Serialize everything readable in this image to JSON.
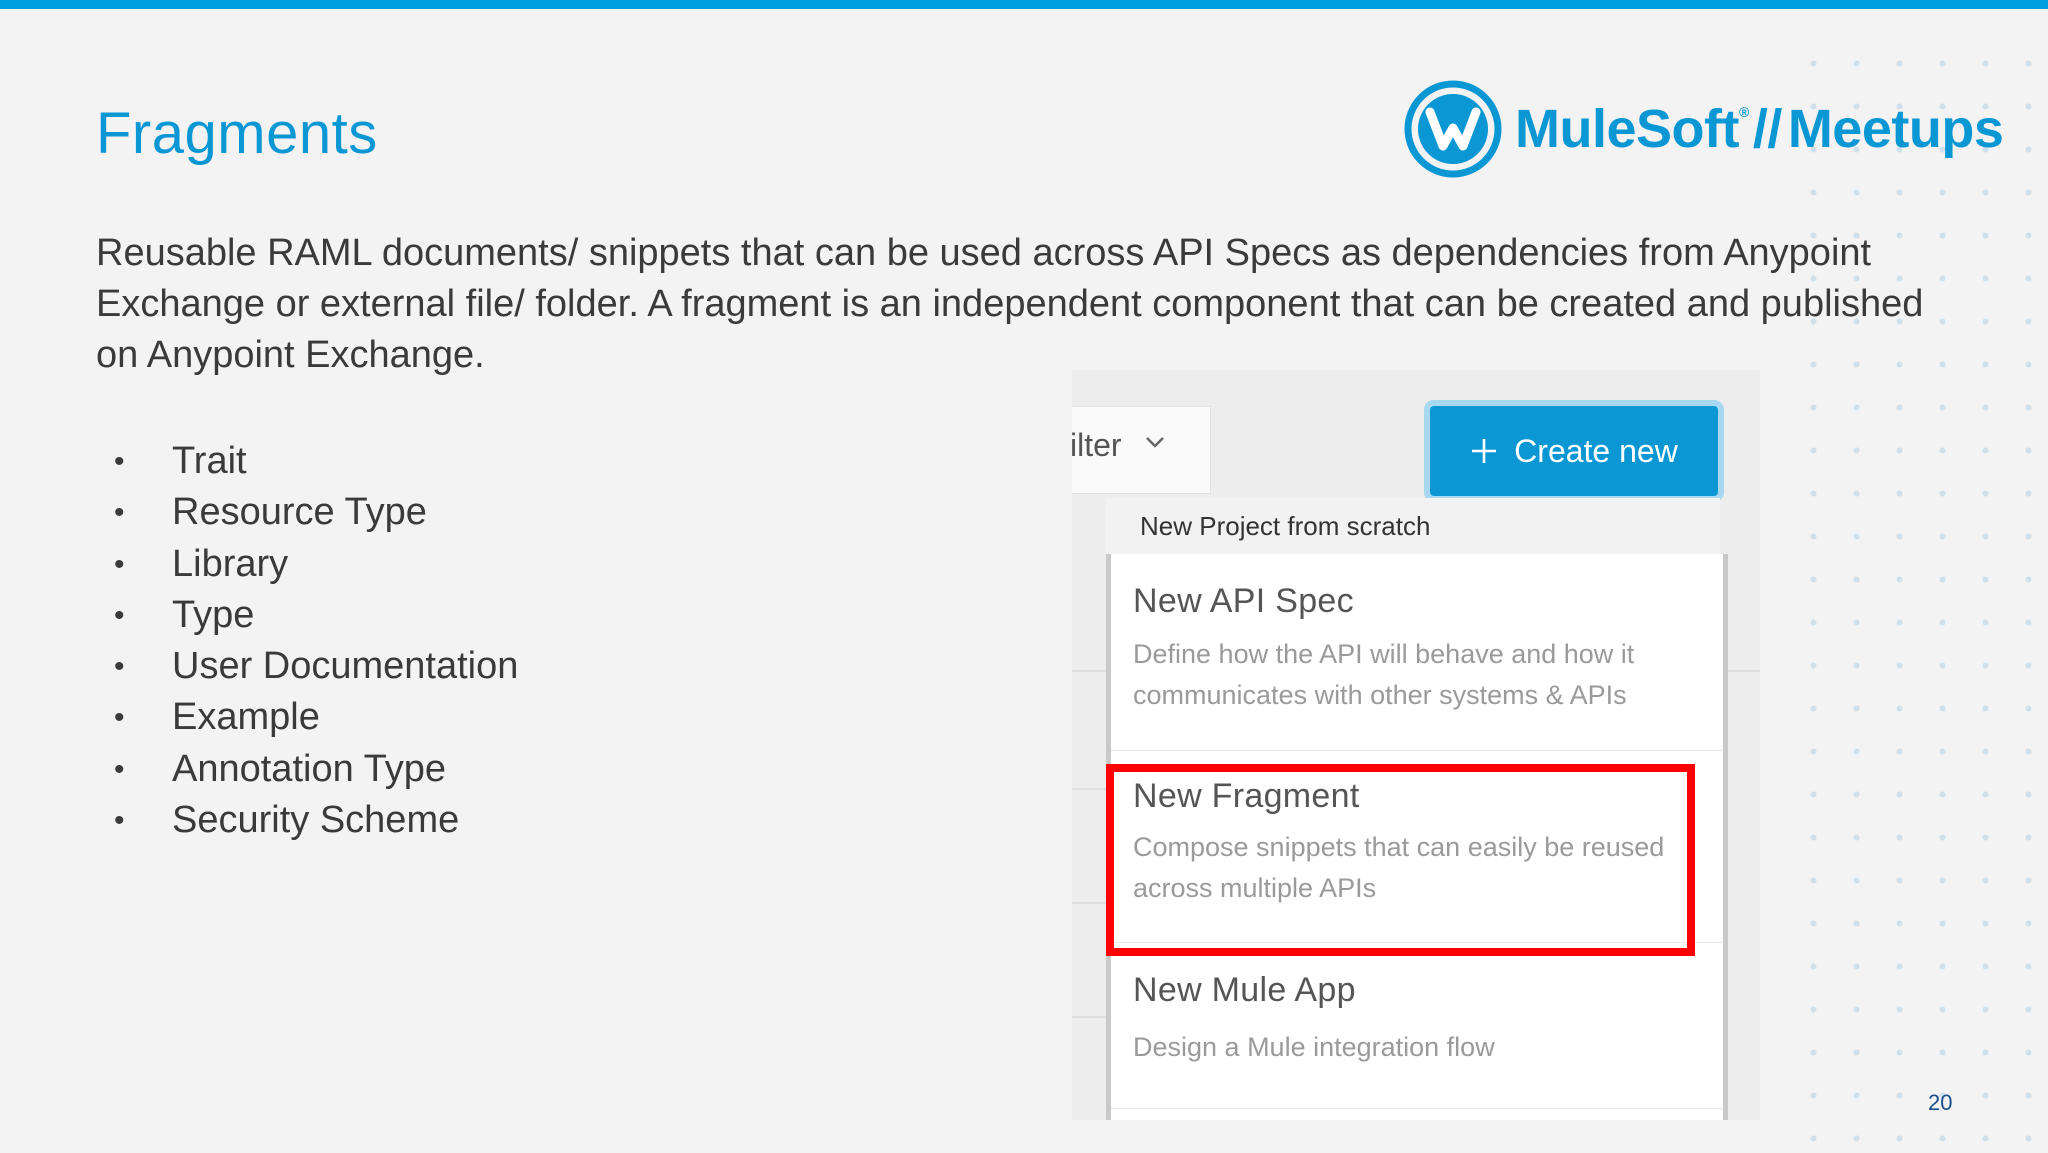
{
  "slide": {
    "title": "Fragments",
    "intro": "Reusable RAML documents/ snippets that can be used across API Specs as dependencies from Anypoint Exchange or external file/ folder. A fragment is an independent component that can be created and published on Anypoint Exchange.",
    "bullets": [
      "Trait",
      "Resource Type",
      "Library",
      "Type",
      "User Documentation",
      "Example",
      "Annotation Type",
      "Security Scheme"
    ],
    "page_number": "20"
  },
  "logo": {
    "brand": "MuleSoft",
    "registered": "®",
    "separator": "//",
    "product": "Meetups"
  },
  "screenshot": {
    "filter_label": "ilter",
    "create_button_label": "Create new",
    "menu_header": "New Project from scratch",
    "menu_items": [
      {
        "title": "New API Spec",
        "description": "Define how the API will behave and how it communicates with other systems & APIs"
      },
      {
        "title": "New Fragment",
        "description": "Compose snippets that can easily be reused across multiple APIs",
        "highlighted": true
      },
      {
        "title": "New Mule App",
        "description": "Design a Mule integration flow"
      }
    ]
  },
  "colors": {
    "accent": "#0a97d4",
    "highlight": "#ff0000",
    "button": "#0a97d4",
    "text": "#3a3a3a"
  },
  "icons": {
    "bullet": "•",
    "plus": "plus-icon",
    "chevron": "chevron-down-icon",
    "logo": "mulesoft-logo-icon"
  }
}
